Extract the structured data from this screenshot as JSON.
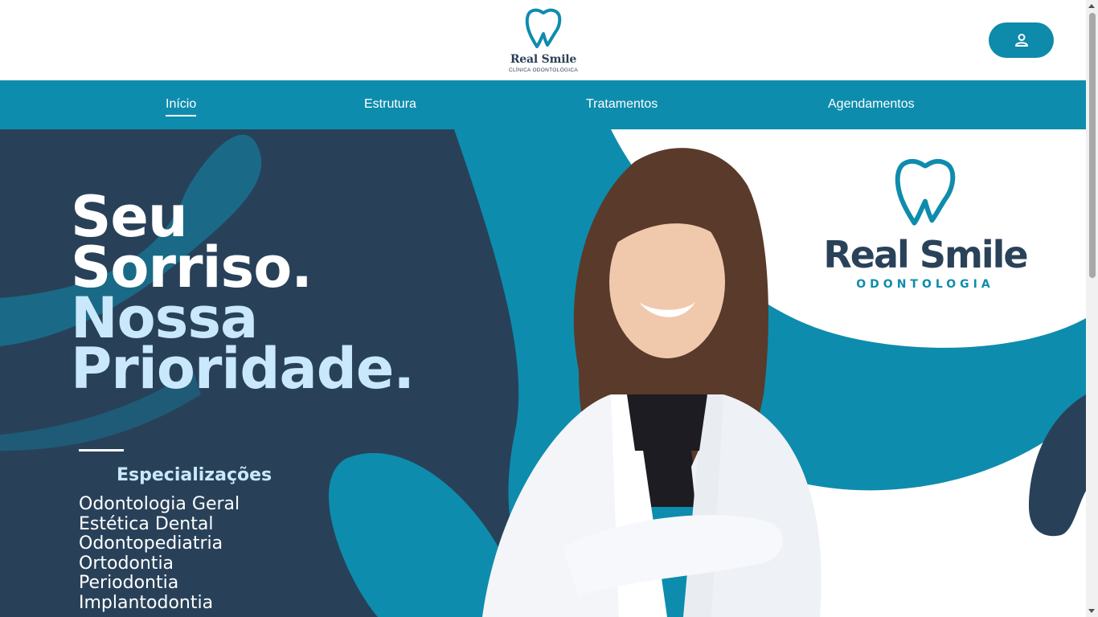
{
  "header": {
    "logo": {
      "name": "Real Smile",
      "subtitle": "CLÍNICA ODONTOLÓGICA",
      "icon": "tooth-icon"
    },
    "user_button": {
      "icon": "user-icon"
    }
  },
  "nav": {
    "items": [
      {
        "label": "Início",
        "active": true
      },
      {
        "label": "Estrutura",
        "active": false
      },
      {
        "label": "Tratamentos",
        "active": false
      },
      {
        "label": "Agendamentos",
        "active": false
      }
    ]
  },
  "hero": {
    "headline": {
      "line1": "Seu",
      "line2": "Sorriso.",
      "line3": "Nossa",
      "line4": "Prioridade."
    },
    "specializations_title": "Especializações",
    "specializations": [
      "Odontologia Geral",
      "Estética Dental",
      "Odontopediatria",
      "Ortodontia",
      "Periodontia",
      "Implantodontia"
    ],
    "brand": {
      "name": "Real Smile",
      "subtitle": "ODONTOLOGIA",
      "icon": "tooth-icon"
    }
  },
  "colors": {
    "primary": "#0e8cad",
    "navy": "#284159",
    "light_blue": "#c9e8fb",
    "white": "#ffffff"
  }
}
